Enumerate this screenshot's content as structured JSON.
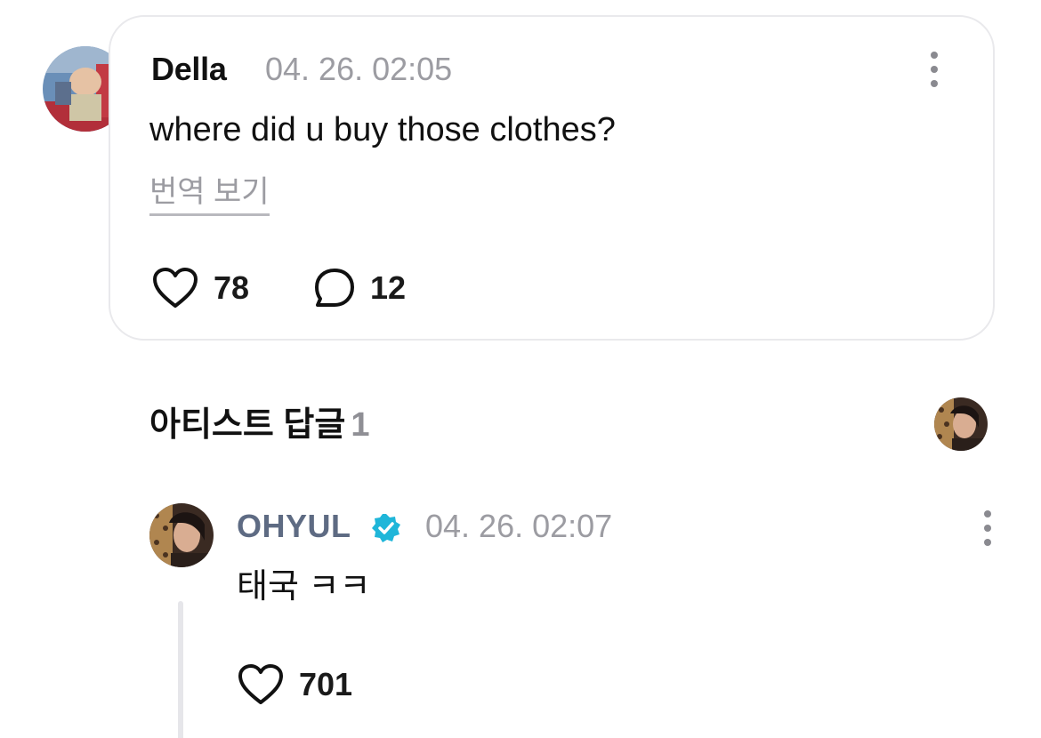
{
  "comment": {
    "author": "Della",
    "timestamp": "04. 26. 02:05",
    "text": "where did u buy those clothes?",
    "translate_label": "번역 보기",
    "likes": "78",
    "replies": "12",
    "more_icon": "more-vertical-icon",
    "like_icon": "heart-outline-icon",
    "reply_icon": "speech-bubble-icon"
  },
  "artist_section": {
    "title": "아티스트 답글",
    "count": "1"
  },
  "reply": {
    "author": "OHYUL",
    "verified_icon": "verified-badge-icon",
    "timestamp": "04. 26. 02:07",
    "text": "태국 ㅋㅋ",
    "likes": "701",
    "more_icon": "more-vertical-icon",
    "like_icon": "heart-outline-icon"
  },
  "colors": {
    "accent_verified": "#1fb6d9",
    "artist_name": "#5e6b83",
    "muted_text": "#9c9ca2",
    "card_border": "#e9e9ec"
  }
}
